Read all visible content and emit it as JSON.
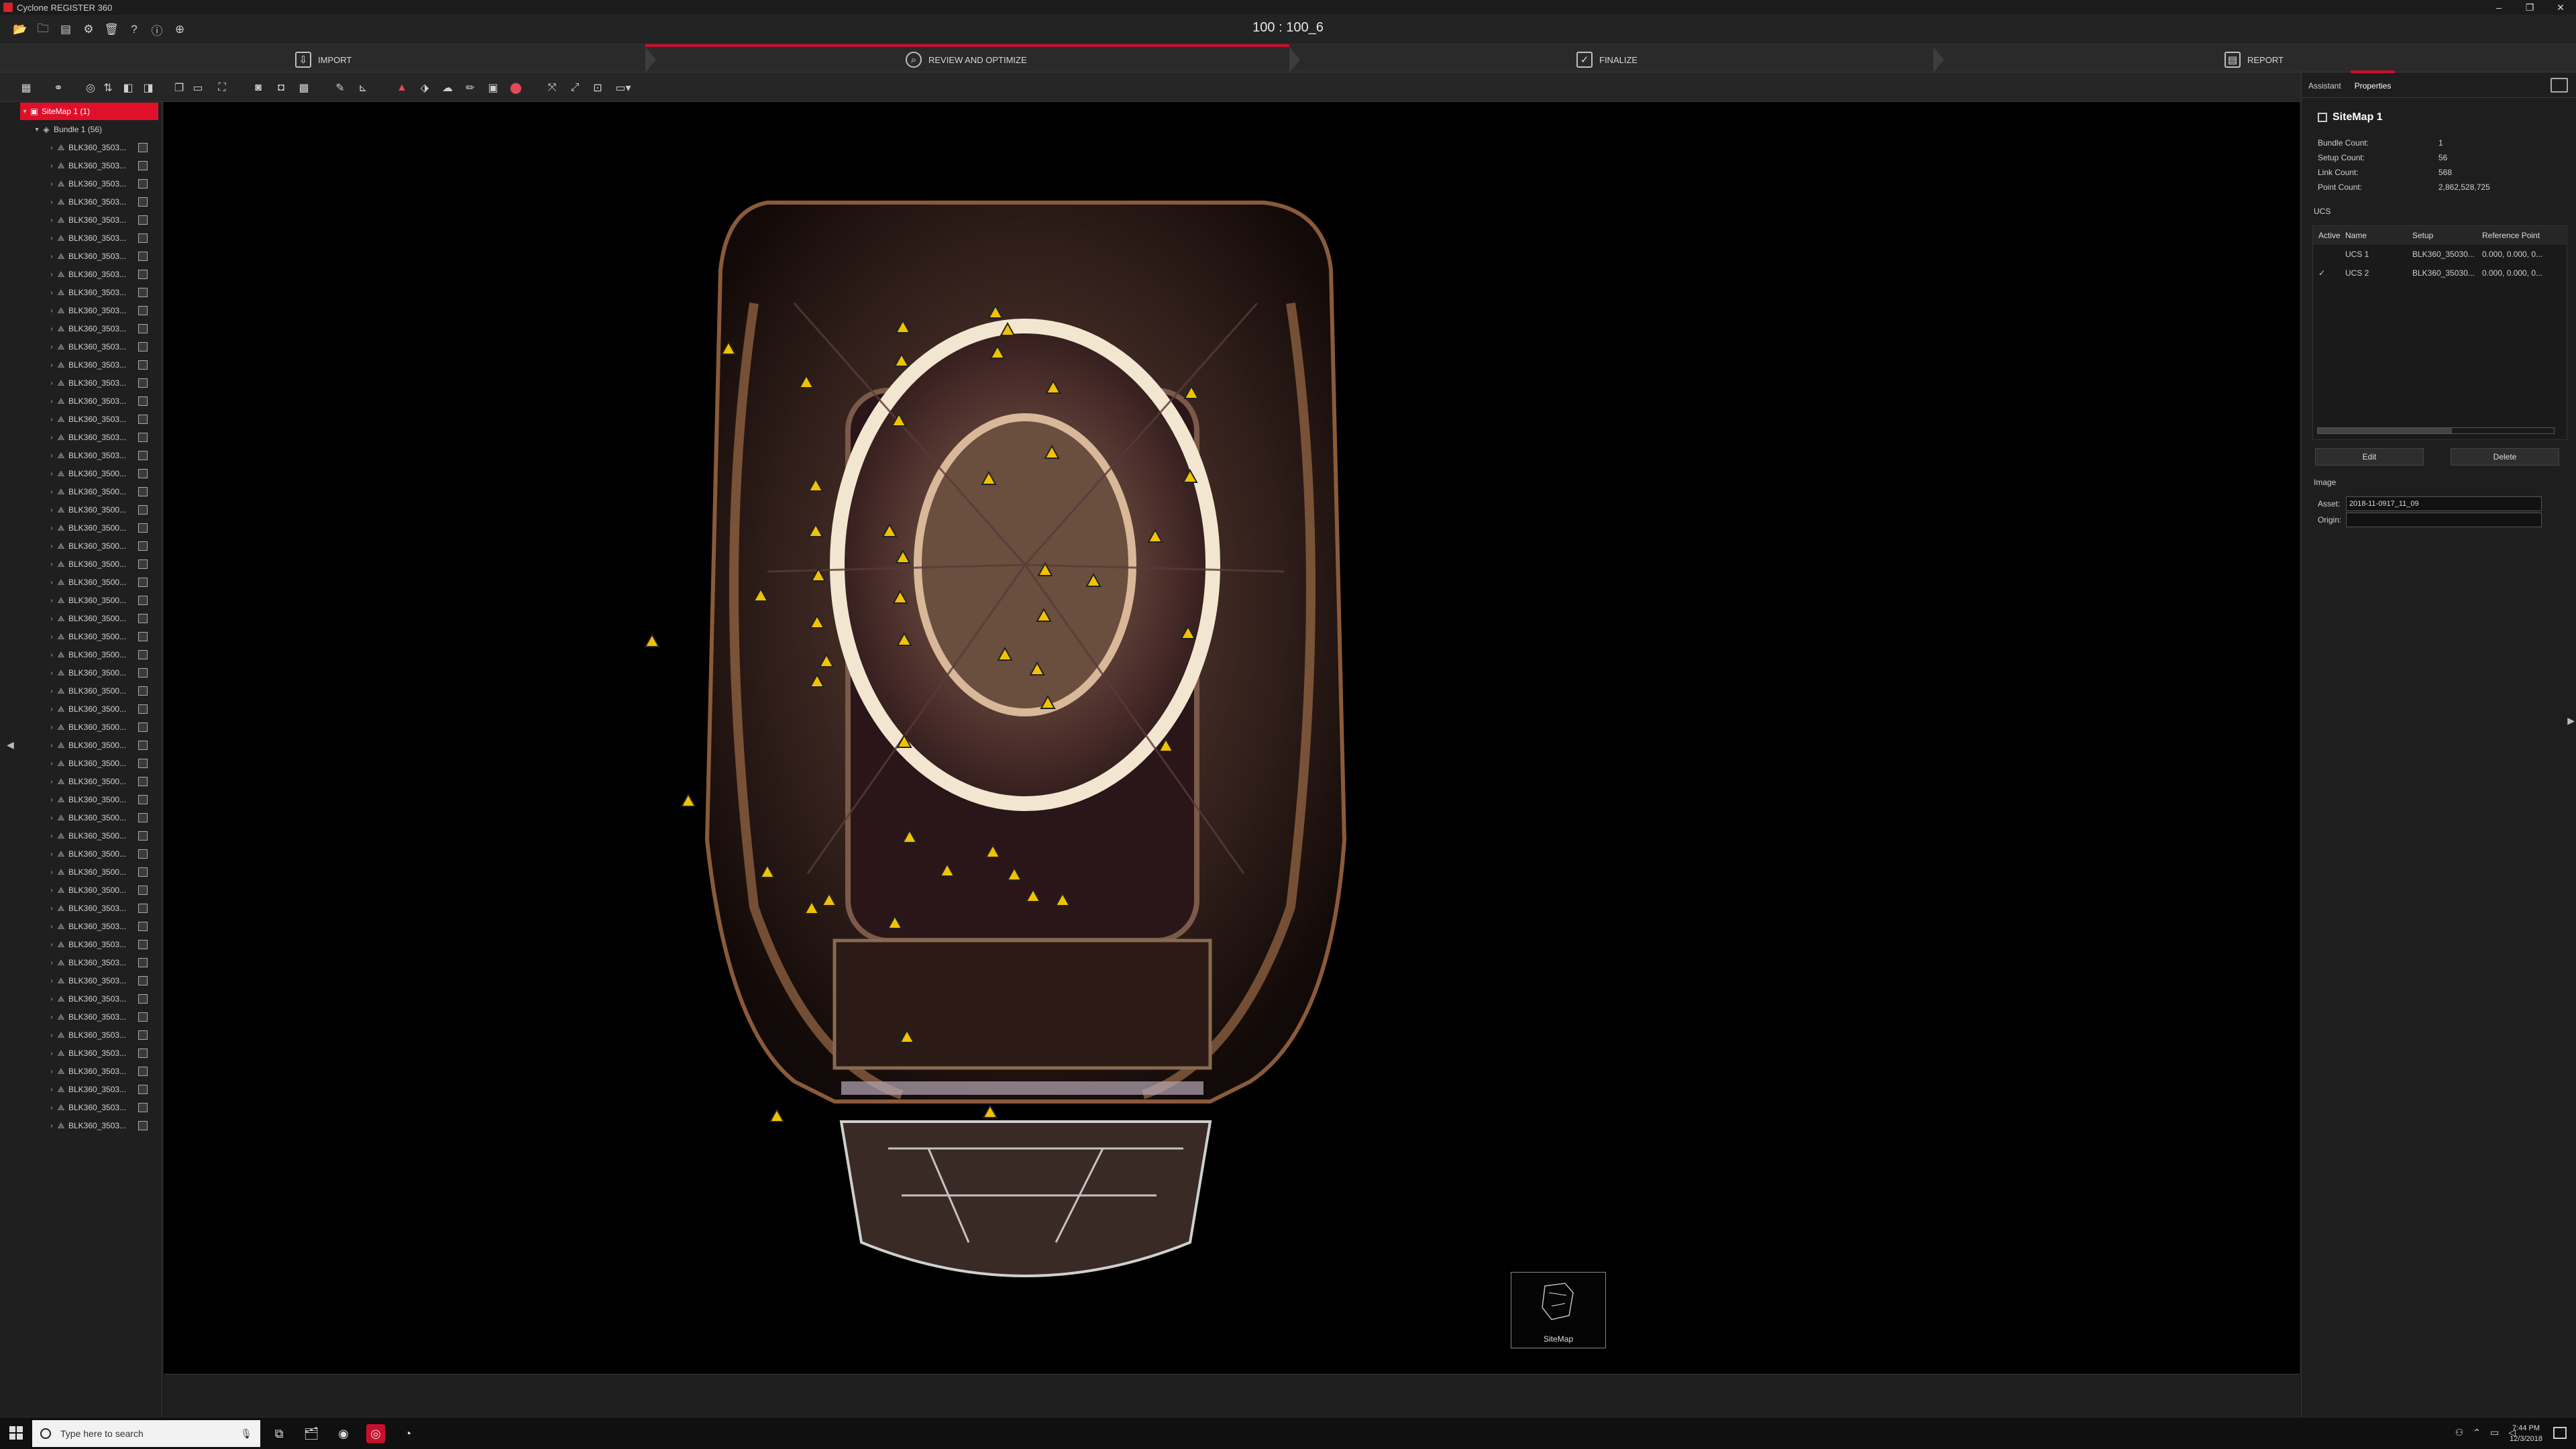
{
  "window": {
    "title": "Cyclone REGISTER 360",
    "controls": [
      "–",
      "❐",
      "✕"
    ]
  },
  "quick_access": {
    "project_title": "100 : 100_6",
    "icons": [
      "folder-open-icon",
      "folder-icon",
      "folder-icon",
      "gear-icon",
      "trash-icon",
      "help-icon",
      "info-icon",
      "globe-icon"
    ]
  },
  "workflow": {
    "steps": [
      {
        "label": "IMPORT",
        "icon": "import-icon"
      },
      {
        "label": "REVIEW AND OPTIMIZE",
        "icon": "review-icon"
      },
      {
        "label": "FINALIZE",
        "icon": "finalize-icon"
      },
      {
        "label": "REPORT",
        "icon": "report-icon"
      }
    ],
    "active_step": "REVIEW AND OPTIMIZE",
    "accent_color": "#c8102e"
  },
  "tree": {
    "sitemap_label": "SiteMap 1 (1)",
    "bundle_label": "Bundle 1 (56)",
    "setups": [
      "BLK360_3503...",
      "BLK360_3503...",
      "BLK360_3503...",
      "BLK360_3503...",
      "BLK360_3503...",
      "BLK360_3503...",
      "BLK360_3503...",
      "BLK360_3503...",
      "BLK360_3503...",
      "BLK360_3503...",
      "BLK360_3503...",
      "BLK360_3503...",
      "BLK360_3503...",
      "BLK360_3503...",
      "BLK360_3503...",
      "BLK360_3503...",
      "BLK360_3503...",
      "BLK360_3503...",
      "BLK360_3500...",
      "BLK360_3500...",
      "BLK360_3500...",
      "BLK360_3500...",
      "BLK360_3500...",
      "BLK360_3500...",
      "BLK360_3500...",
      "BLK360_3500...",
      "BLK360_3500...",
      "BLK360_3500...",
      "BLK360_3500...",
      "BLK360_3500...",
      "BLK360_3500...",
      "BLK360_3500...",
      "BLK360_3500...",
      "BLK360_3500...",
      "BLK360_3500...",
      "BLK360_3500...",
      "BLK360_3500...",
      "BLK360_3500...",
      "BLK360_3500...",
      "BLK360_3500...",
      "BLK360_3500...",
      "BLK360_3500...",
      "BLK360_3503...",
      "BLK360_3503...",
      "BLK360_3503...",
      "BLK360_3503...",
      "BLK360_3503...",
      "BLK360_3503...",
      "BLK360_3503...",
      "BLK360_3503...",
      "BLK360_3503...",
      "BLK360_3503...",
      "BLK360_3503...",
      "BLK360_3503...",
      "BLK360_3503..."
    ]
  },
  "viewport": {
    "minimap_label": "SiteMap",
    "marker_color": "#f2c200"
  },
  "right_panel": {
    "tabs": [
      "Assistant",
      "Properties"
    ],
    "active_tab": "Properties",
    "title": "SiteMap 1",
    "stats": [
      {
        "label": "Bundle Count:",
        "value": "1"
      },
      {
        "label": "Setup Count:",
        "value": "56"
      },
      {
        "label": "Link Count:",
        "value": "568"
      },
      {
        "label": "Point Count:",
        "value": "2,862,528,725"
      }
    ],
    "ucs_section": "UCS",
    "ucs_columns": [
      "Active",
      "Name",
      "Setup",
      "Reference Point"
    ],
    "ucs_rows": [
      {
        "active": "",
        "name": "UCS 1",
        "setup": "BLK360_35030...",
        "ref": "0.000, 0.000, 0..."
      },
      {
        "active": "✓",
        "name": "UCS 2",
        "setup": "BLK360_35030...",
        "ref": "0.000, 0.000, 0..."
      }
    ],
    "edit_label": "Edit",
    "delete_label": "Delete",
    "image_section": "Image",
    "asset_label": "Asset:",
    "asset_value": "2018-11-0917_11_09",
    "origin_label": "Origin:",
    "origin_value": ""
  },
  "taskbar": {
    "search_placeholder": "Type here to search",
    "time": "7:44 PM",
    "date": "12/3/2018"
  }
}
